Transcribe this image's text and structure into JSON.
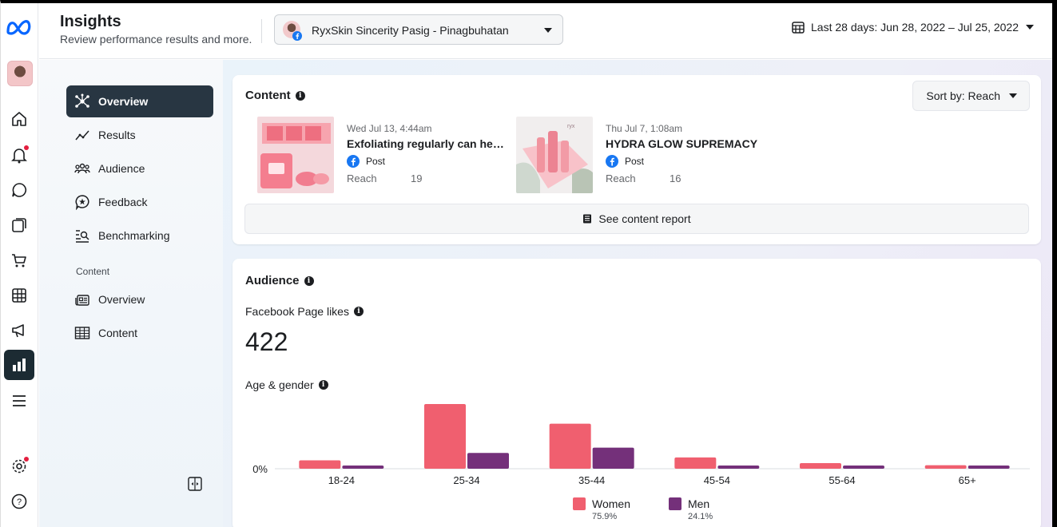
{
  "header": {
    "title": "Insights",
    "subtitle": "Review performance results and more.",
    "page_selector": "RyxSkin Sincerity Pasig - Pinagbuhatan",
    "date_range": "Last 28 days: Jun 28, 2022 – Jul 25, 2022"
  },
  "rail": {
    "icons": [
      "meta-logo",
      "page-avatar",
      "home-icon",
      "bell-icon",
      "chat-icon",
      "pages-icon",
      "shop-icon",
      "table-icon",
      "megaphone-icon",
      "insights-icon",
      "menu-icon",
      "settings-icon",
      "help-icon"
    ]
  },
  "nav": {
    "items": [
      {
        "label": "Overview",
        "icon": "overview-icon"
      },
      {
        "label": "Results",
        "icon": "results-icon"
      },
      {
        "label": "Audience",
        "icon": "audience-icon"
      },
      {
        "label": "Feedback",
        "icon": "feedback-icon"
      },
      {
        "label": "Benchmarking",
        "icon": "benchmarking-icon"
      }
    ],
    "section_label": "Content",
    "content_items": [
      {
        "label": "Overview",
        "icon": "content-overview-icon"
      },
      {
        "label": "Content",
        "icon": "content-table-icon"
      }
    ]
  },
  "content_card": {
    "title": "Content",
    "sort_label": "Sort by: Reach",
    "posts": [
      {
        "date": "Wed Jul 13, 4:44am",
        "title": "Exfoliating regularly can help keep your skin",
        "type": "Post",
        "metric_label": "Reach",
        "metric_value": "19"
      },
      {
        "date": "Thu Jul 7, 1:08am",
        "title": "HYDRA GLOW SUPREMACY",
        "type": "Post",
        "metric_label": "Reach",
        "metric_value": "16"
      }
    ],
    "report_button": "See content report"
  },
  "audience_card": {
    "title": "Audience",
    "likes_label": "Facebook Page likes",
    "likes_value": "422",
    "age_gender_label": "Age & gender"
  },
  "colors": {
    "women": "#f05f6f",
    "men": "#74307a",
    "nav_active": "#283642"
  },
  "chart_data": {
    "type": "bar",
    "categories": [
      "18-24",
      "25-34",
      "35-44",
      "45-54",
      "55-64",
      "65+"
    ],
    "series": [
      {
        "name": "Women",
        "values": [
          2.4,
          18.4,
          12.8,
          3.2,
          1.6,
          1.0
        ],
        "percent": "75.9%"
      },
      {
        "name": "Men",
        "values": [
          0.9,
          4.5,
          6.0,
          0.9,
          0.9,
          0.9
        ],
        "percent": "24.1%"
      }
    ],
    "ylim": [
      0,
      20
    ],
    "y_tick_labels": [
      "0%"
    ],
    "legend_position": "bottom",
    "grid": false
  }
}
